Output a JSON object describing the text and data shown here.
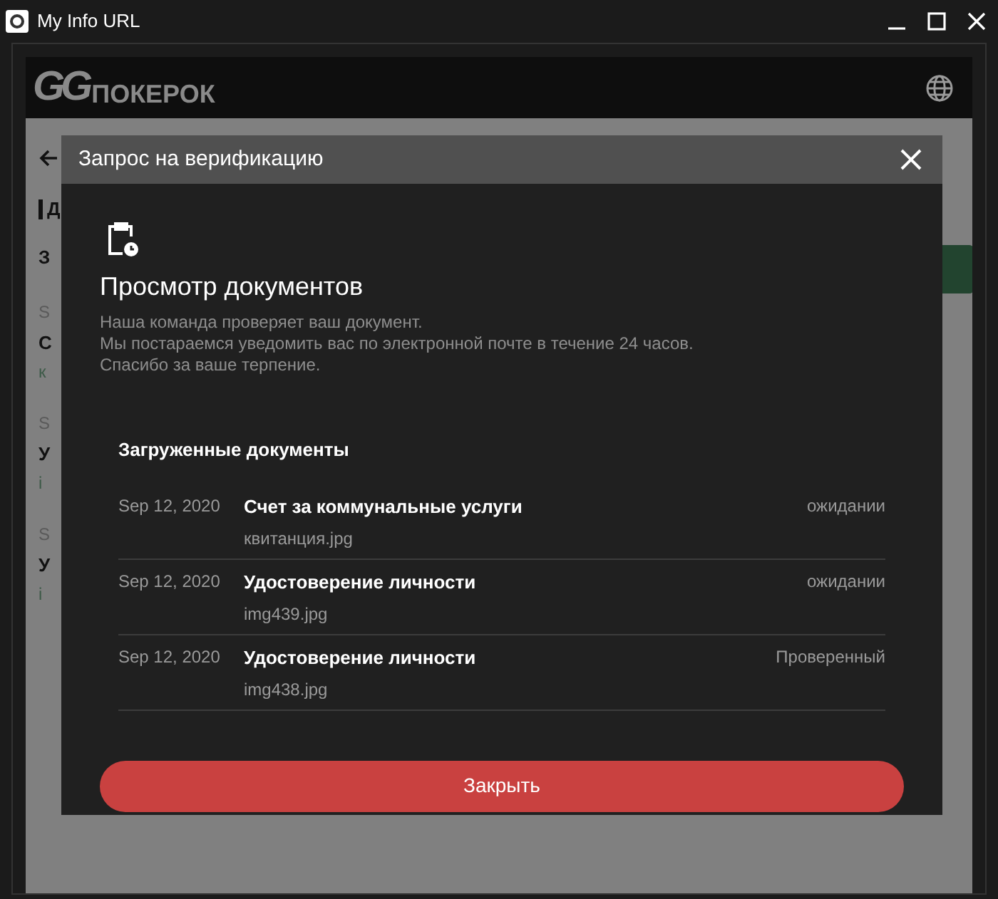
{
  "window": {
    "title": "My Info URL"
  },
  "header": {
    "logo_mark": "GG",
    "logo_text": "ПОКЕРОК"
  },
  "background_page": {
    "heading": "Д",
    "fragments": [
      {
        "text": "З",
        "kind": "label"
      },
      {
        "text": "S",
        "kind": "date"
      },
      {
        "text": "С",
        "kind": "title"
      },
      {
        "text": "к",
        "kind": "file"
      },
      {
        "text": "S",
        "kind": "date"
      },
      {
        "text": "У",
        "kind": "title"
      },
      {
        "text": "i",
        "kind": "file"
      },
      {
        "text": "S",
        "kind": "date"
      },
      {
        "text": "У",
        "kind": "title"
      },
      {
        "text": "i",
        "kind": "file"
      }
    ]
  },
  "modal": {
    "title": "Запрос на верификацию",
    "heading": "Просмотр документов",
    "description": [
      "Наша команда проверяет ваш документ.",
      "Мы постараемся уведомить вас по электронной почте в течение 24 часов.",
      "Спасибо за ваше терпение."
    ],
    "section_title": "Загруженные документы",
    "documents": [
      {
        "date": "Sep 12, 2020",
        "name": "Счет за коммунальные услуги",
        "file": "квитанция.jpg",
        "status": "ожидании"
      },
      {
        "date": "Sep 12, 2020",
        "name": "Удостоверение личности",
        "file": "img439.jpg",
        "status": "ожидании"
      },
      {
        "date": "Sep 12, 2020",
        "name": "Удостоверение личности",
        "file": "img438.jpg",
        "status": "Проверенный"
      }
    ],
    "close_button": "Закрыть"
  }
}
